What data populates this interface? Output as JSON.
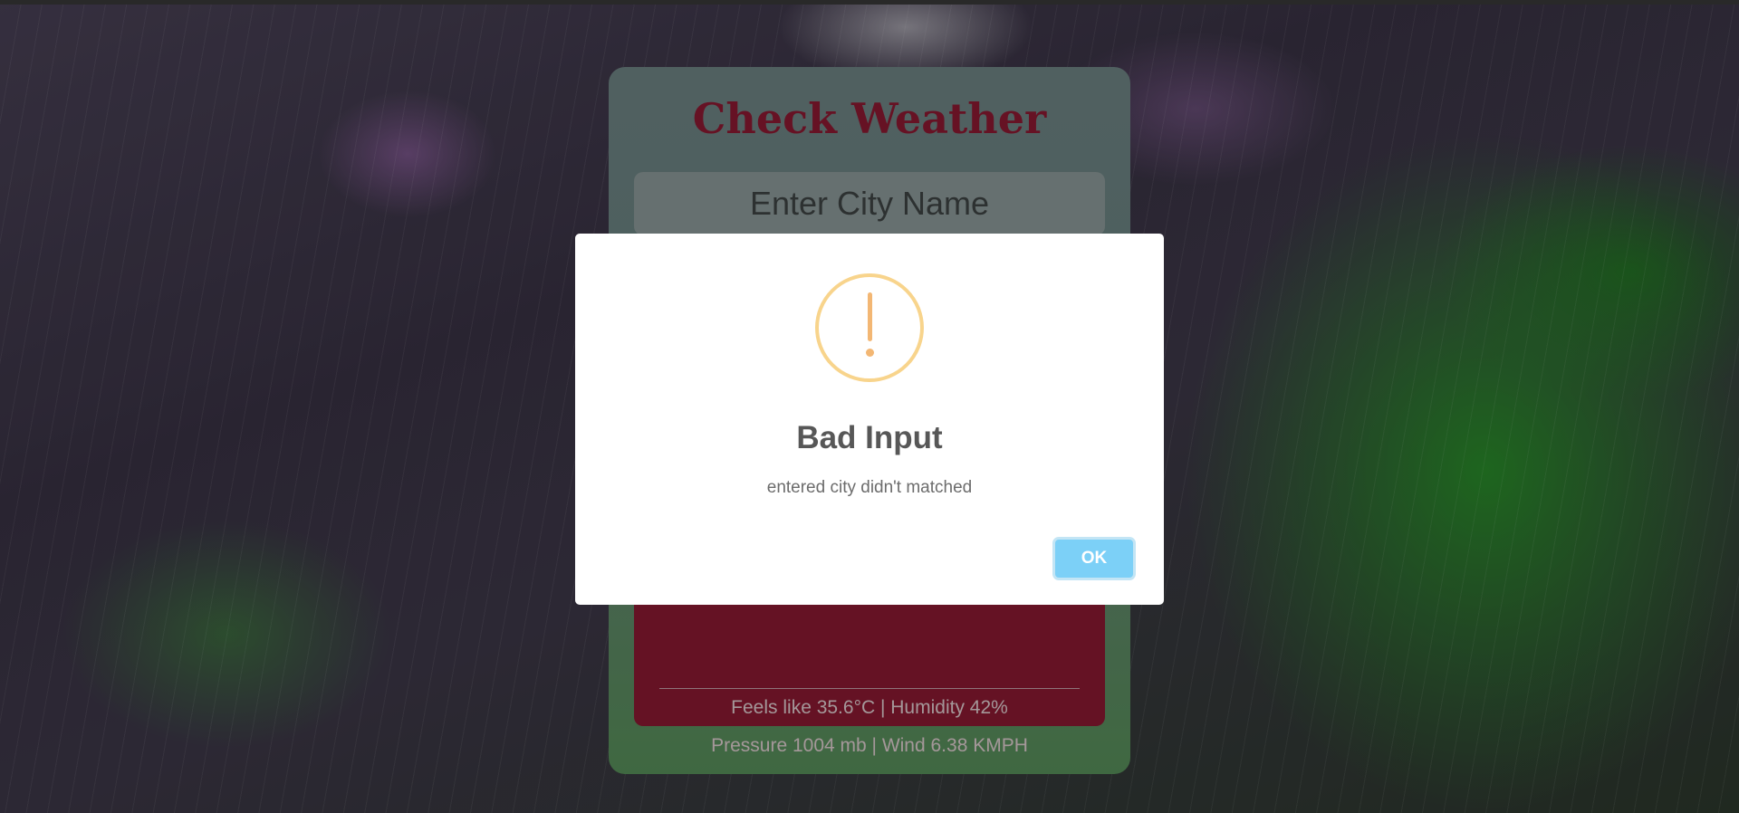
{
  "app": {
    "title": "Check Weather"
  },
  "search": {
    "placeholder": "Enter City Name",
    "value": ""
  },
  "weather": {
    "details_line_1": "Feels like 35.6°C | Humidity 42%",
    "details_line_2": "Pressure 1004 mb | Wind 6.38 KMPH"
  },
  "alert": {
    "icon": "warning-icon",
    "title": "Bad Input",
    "message": "entered city didn't matched",
    "confirm_label": "OK"
  },
  "colors": {
    "title": "#8e1a33",
    "result_panel": "#8c1a32",
    "warning": "#f8d48c",
    "ok_button": "#7cd0f7"
  }
}
